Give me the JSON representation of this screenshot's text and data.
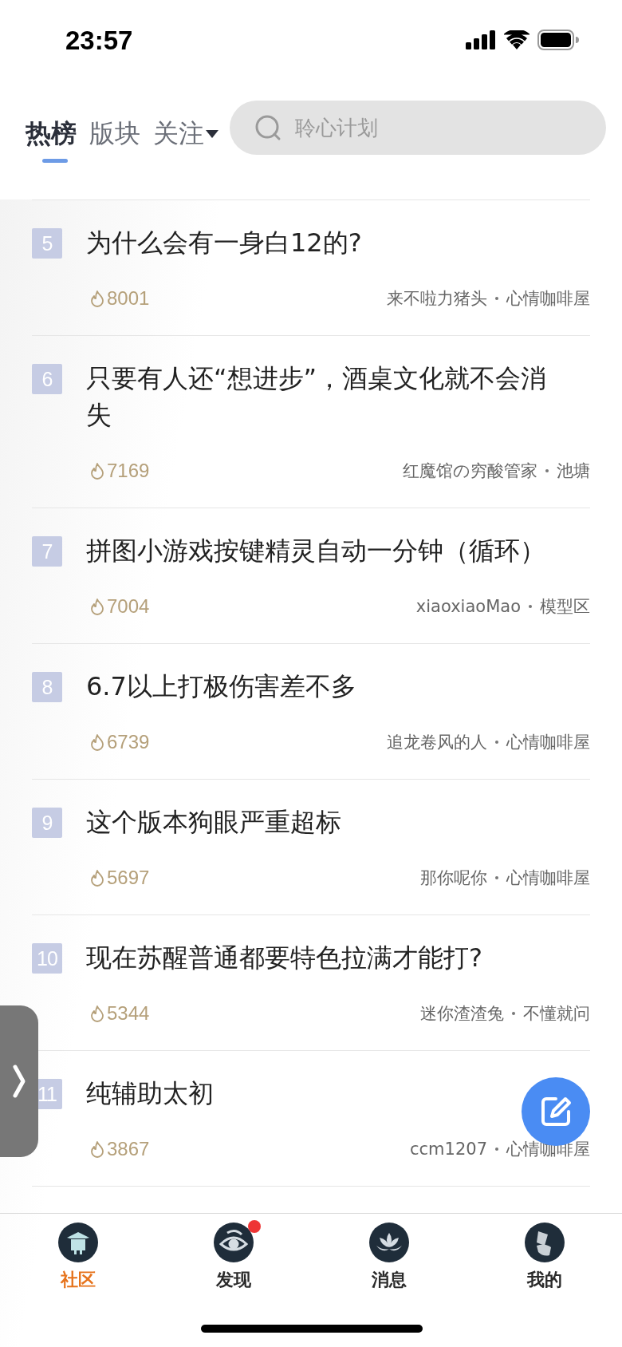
{
  "status_bar": {
    "time": "23:57"
  },
  "tabs": [
    {
      "label": "热榜",
      "selected": true,
      "dropdown": false
    },
    {
      "label": "版块",
      "selected": false,
      "dropdown": false
    },
    {
      "label": "关注",
      "selected": false,
      "dropdown": true
    }
  ],
  "search": {
    "placeholder": "聆心计划"
  },
  "posts": [
    {
      "rank": "5",
      "title": "为什么会有一身白12的?",
      "heat": "8001",
      "author": "来不啦力猪头",
      "board": "心情咖啡屋"
    },
    {
      "rank": "6",
      "title": "只要有人还“想进步”，酒桌文化就不会消失",
      "heat": "7169",
      "author": "红魔馆の穷酸管家",
      "board": "池塘"
    },
    {
      "rank": "7",
      "title": "拼图小游戏按键精灵自动一分钟（循环）",
      "heat": "7004",
      "author": "xiaoxiaoMao",
      "board": "模型区"
    },
    {
      "rank": "8",
      "title": "6.7以上打极伤害差不多",
      "heat": "6739",
      "author": "追龙卷风的人",
      "board": "心情咖啡屋"
    },
    {
      "rank": "9",
      "title": "这个版本狗眼严重超标",
      "heat": "5697",
      "author": "那你呢你",
      "board": "心情咖啡屋"
    },
    {
      "rank": "10",
      "title": "现在苏醒普通都要特色拉满才能打?",
      "heat": "5344",
      "author": "迷你渣渣兔",
      "board": "不懂就问"
    },
    {
      "rank": "11",
      "title": "纯辅助太初",
      "heat": "3867",
      "author": "ccm1207",
      "board": "心情咖啡屋"
    }
  ],
  "bottom_nav": [
    {
      "label": "社区",
      "selected": true,
      "badge": false,
      "kind": "pavilion"
    },
    {
      "label": "发现",
      "selected": false,
      "badge": true,
      "kind": "eye"
    },
    {
      "label": "消息",
      "selected": false,
      "badge": false,
      "kind": "lotus"
    },
    {
      "label": "我的",
      "selected": false,
      "badge": false,
      "kind": "figure"
    }
  ]
}
